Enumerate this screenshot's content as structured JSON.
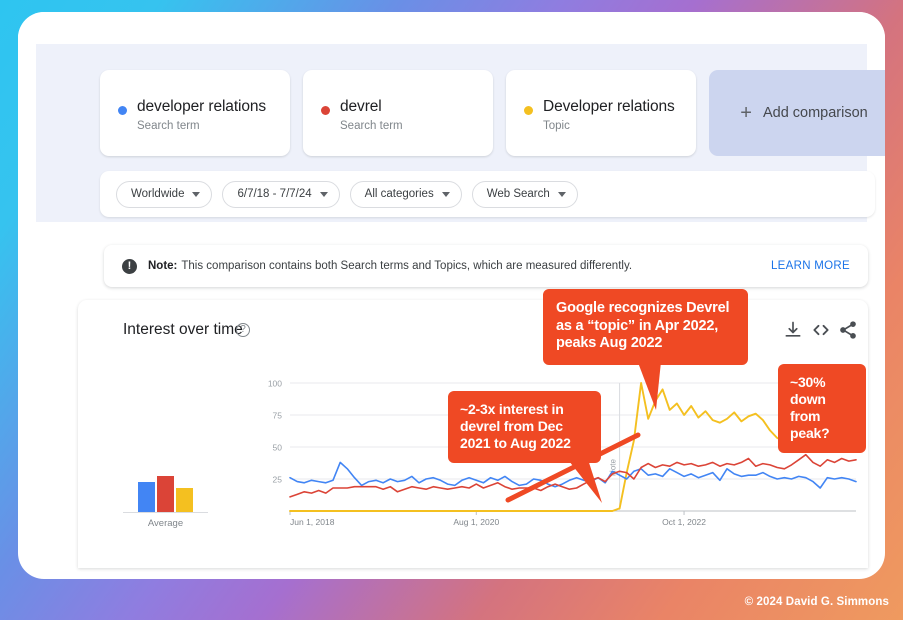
{
  "background": {
    "gradient_start": "#2ec5f0",
    "gradient_mid": "#8f7de0",
    "gradient_end": "#ef9a5f"
  },
  "accent": {
    "blue": "#4285f4",
    "red": "#db4437",
    "yellow": "#f4c020",
    "link": "#1a73e8",
    "callout": "#ef4924",
    "tab_indicator": "#3b7df6"
  },
  "comparison": {
    "terms": [
      {
        "name": "developer relations",
        "type": "Search term",
        "color": "#4285f4"
      },
      {
        "name": "devrel",
        "type": "Search term",
        "color": "#db4437"
      },
      {
        "name": "Developer relations",
        "type": "Topic",
        "color": "#f4c020"
      }
    ],
    "add_button": {
      "plus": "+",
      "label": "Add comparison"
    }
  },
  "filters": [
    {
      "name": "region",
      "label": "Worldwide"
    },
    {
      "name": "date-range",
      "label": "6/7/18 - 7/7/24"
    },
    {
      "name": "category",
      "label": "All categories"
    },
    {
      "name": "search-type",
      "label": "Web Search"
    }
  ],
  "note": {
    "icon_glyph": "!",
    "label": "Note:",
    "text": "This comparison contains both Search terms and Topics, which are measured differently.",
    "learn_more": "LEARN MORE"
  },
  "chart_card": {
    "title": "Interest over time",
    "help_glyph": "?",
    "actions": [
      {
        "name": "download-icon",
        "title": "Download"
      },
      {
        "name": "embed-code-icon",
        "title": "Embed"
      },
      {
        "name": "share-icon",
        "title": "Share"
      }
    ],
    "average_legend_label": "Average"
  },
  "annotations": [
    {
      "name": "topic-callout",
      "text": "Google recognizes Devrel as a “topic” in Apr 2022, peaks Aug 2022"
    },
    {
      "name": "devrel-growth-callout",
      "text": "~2-3x interest in devrel from Dec 2021 to Aug 2022"
    },
    {
      "name": "decline-callout",
      "text": "~30% down from peak?"
    },
    {
      "name": "chart-note-marker",
      "text": "Note"
    }
  ],
  "footer": {
    "copyright": "© 2024 David G. Simmons"
  },
  "chart_data": {
    "type": "line",
    "title": "Interest over time",
    "xlabel": "",
    "ylabel": "",
    "ylim": [
      0,
      100
    ],
    "yticks": [
      25,
      50,
      75,
      100
    ],
    "ytick_labels": [
      "25",
      "50",
      "75",
      "100"
    ],
    "grid": true,
    "legend_position": "cards-above",
    "xticks": [
      0,
      26,
      55
    ],
    "xtick_labels": [
      "Jun 1, 2018",
      "Aug 1, 2020",
      "Oct 1, 2022"
    ],
    "average_bars": {
      "categories": [
        "developer relations",
        "devrel",
        "Developer relations"
      ],
      "values": [
        27,
        32,
        21
      ]
    },
    "series": [
      {
        "name": "developer relations",
        "type": "Search term",
        "color": "#4285f4",
        "values": [
          26,
          23,
          22,
          24,
          23,
          22,
          24,
          38,
          33,
          26,
          20,
          23,
          24,
          22,
          25,
          23,
          24,
          27,
          22,
          25,
          26,
          24,
          21,
          20,
          24,
          26,
          24,
          22,
          26,
          24,
          27,
          23,
          20,
          21,
          25,
          24,
          21,
          19,
          21,
          24,
          26,
          24,
          23,
          26,
          22,
          31,
          28,
          25,
          31,
          33,
          28,
          29,
          27,
          33,
          30,
          27,
          29,
          26,
          28,
          30,
          24,
          33,
          29,
          27,
          28,
          28,
          30,
          27,
          25,
          26,
          25,
          27,
          26,
          23,
          18,
          26,
          25,
          26,
          25,
          23
        ]
      },
      {
        "name": "devrel",
        "type": "Search term",
        "color": "#db4437",
        "values": [
          11,
          13,
          15,
          14,
          16,
          14,
          18,
          18,
          18,
          19,
          19,
          19,
          19,
          17,
          19,
          15,
          17,
          19,
          18,
          17,
          19,
          18,
          17,
          18,
          19,
          18,
          21,
          18,
          20,
          22,
          19,
          17,
          18,
          18,
          18,
          16,
          19,
          21,
          19,
          17,
          18,
          21,
          24,
          26,
          23,
          29,
          31,
          30,
          25,
          34,
          37,
          34,
          36,
          35,
          38,
          36,
          37,
          35,
          36,
          38,
          35,
          37,
          36,
          38,
          41,
          35,
          37,
          36,
          34,
          33,
          36,
          40,
          44,
          38,
          35,
          40,
          38,
          41,
          39,
          40
        ]
      },
      {
        "name": "Developer relations",
        "type": "Topic",
        "color": "#f4c020",
        "values": [
          0,
          0,
          0,
          0,
          0,
          0,
          0,
          0,
          0,
          0,
          0,
          0,
          0,
          0,
          0,
          0,
          0,
          0,
          0,
          0,
          0,
          0,
          0,
          0,
          0,
          0,
          0,
          0,
          0,
          0,
          0,
          0,
          0,
          0,
          0,
          0,
          0,
          0,
          0,
          0,
          0,
          0,
          0,
          0,
          0,
          0,
          2,
          30,
          55,
          100,
          72,
          86,
          95,
          79,
          84,
          75,
          82,
          73,
          78,
          71,
          69,
          72,
          77,
          70,
          74,
          76,
          71,
          63,
          57,
          55,
          52,
          56,
          63,
          58,
          56,
          63,
          58,
          61,
          59,
          62
        ]
      }
    ]
  }
}
